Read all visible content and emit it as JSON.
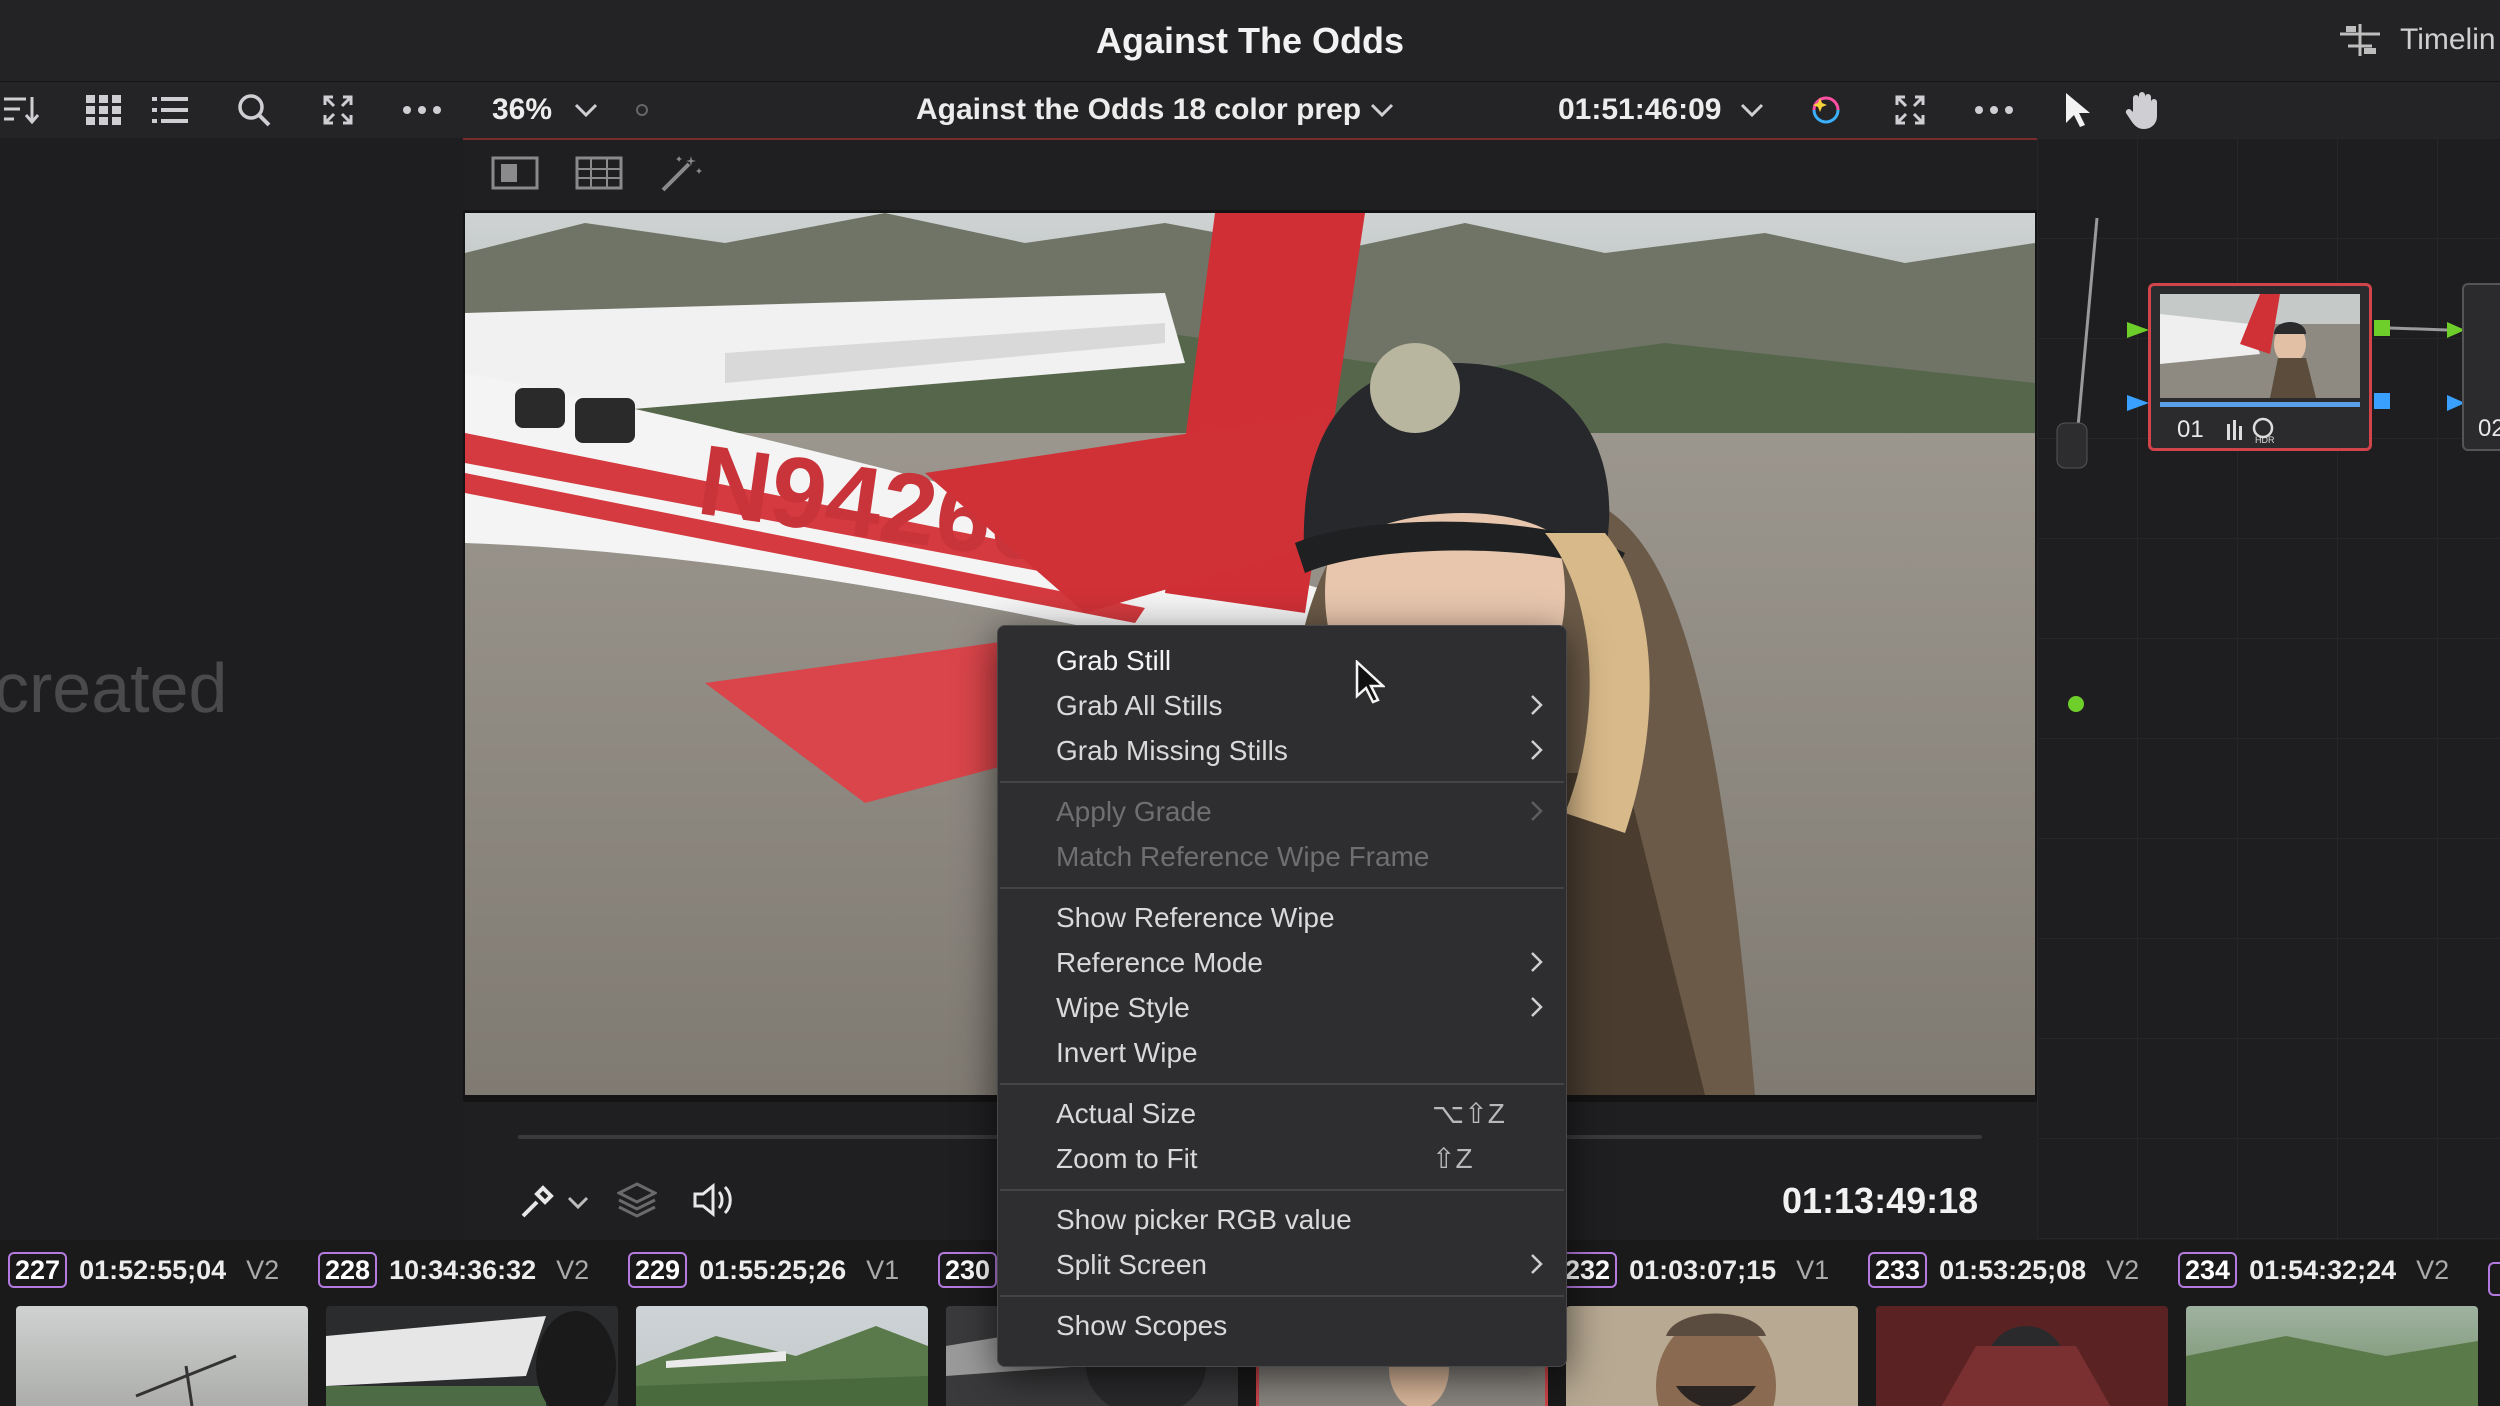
{
  "window": {
    "title": "Against The Odds",
    "timeline_label": "Timelin"
  },
  "viewer": {
    "zoom": "36%",
    "timeline_name": "Against the Odds 18 color prep",
    "source_timecode": "01:51:46:09",
    "playhead_timecode": "01:13:49:18"
  },
  "left_panel": {
    "empty_text": "created"
  },
  "nodes": [
    {
      "label": "01"
    },
    {
      "label": "02"
    }
  ],
  "clips": [
    {
      "num": "227",
      "timecode": "01:52:55;04",
      "track": "V2"
    },
    {
      "num": "228",
      "timecode": "10:34:36:32",
      "track": "V2"
    },
    {
      "num": "229",
      "timecode": "01:55:25;26",
      "track": "V1"
    },
    {
      "num": "230",
      "timecode": "",
      "track": ""
    },
    {
      "num": "232",
      "timecode": "01:03:07;15",
      "track": "V1"
    },
    {
      "num": "233",
      "timecode": "01:53:25;08",
      "track": "V2"
    },
    {
      "num": "234",
      "timecode": "01:54:32;24",
      "track": "V2"
    }
  ],
  "context_menu": {
    "grab_still": "Grab Still",
    "grab_all_stills": "Grab All Stills",
    "grab_missing_stills": "Grab Missing Stills",
    "apply_grade": "Apply Grade",
    "match_reference_wipe_frame": "Match Reference Wipe Frame",
    "show_reference_wipe": "Show Reference Wipe",
    "reference_mode": "Reference Mode",
    "wipe_style": "Wipe Style",
    "invert_wipe": "Invert Wipe",
    "actual_size": "Actual Size",
    "actual_size_shortcut": "⌥⇧Z",
    "zoom_to_fit": "Zoom to Fit",
    "zoom_to_fit_shortcut": "⇧Z",
    "show_picker_rgb": "Show picker RGB value",
    "split_screen": "Split Screen",
    "show_scopes": "Show Scopes"
  },
  "colors": {
    "accent_red": "#d0444a",
    "clip_number_border": "#b47ae0",
    "node_green": "#6fcf2a",
    "node_blue": "#3aa0ff"
  }
}
